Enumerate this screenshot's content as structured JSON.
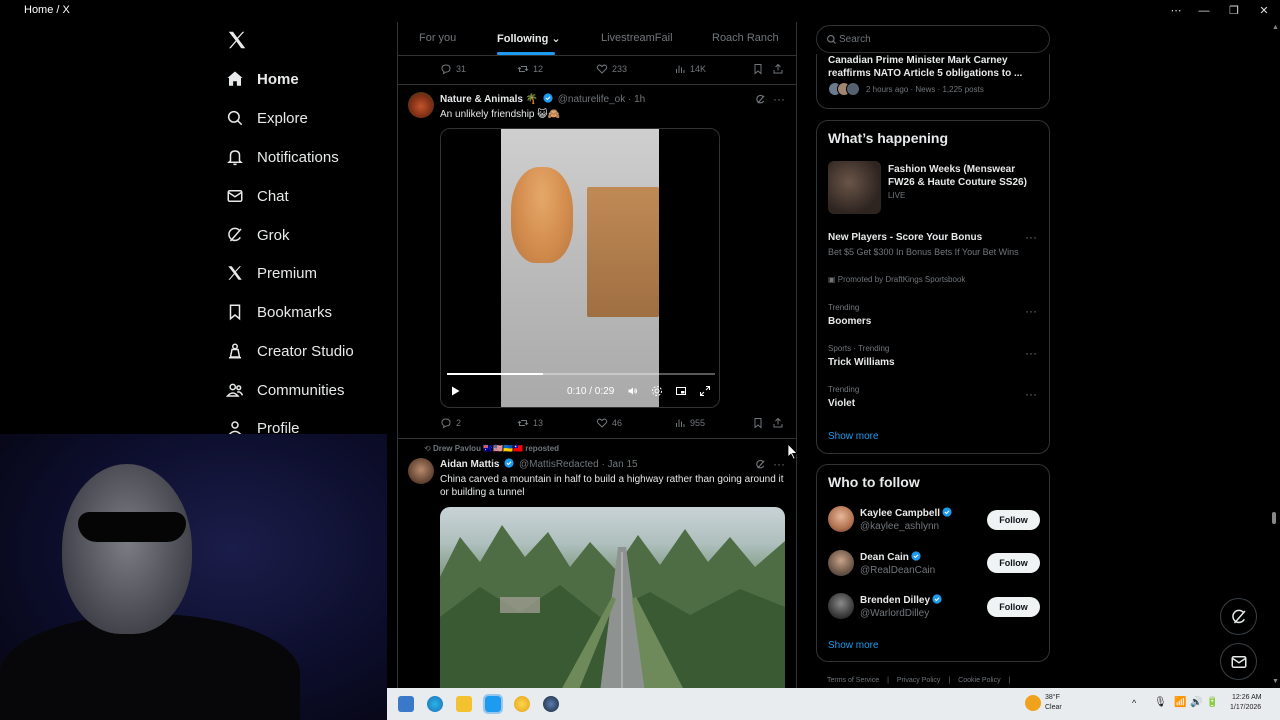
{
  "window": {
    "title": "Home / X"
  },
  "nav": {
    "items": [
      {
        "label": "Home",
        "icon": "home-icon"
      },
      {
        "label": "Explore",
        "icon": "search-icon"
      },
      {
        "label": "Notifications",
        "icon": "bell-icon"
      },
      {
        "label": "Chat",
        "icon": "mail-icon"
      },
      {
        "label": "Grok",
        "icon": "grok-icon"
      },
      {
        "label": "Premium",
        "icon": "x-icon"
      },
      {
        "label": "Bookmarks",
        "icon": "bookmark-icon"
      },
      {
        "label": "Creator Studio",
        "icon": "creator-icon"
      },
      {
        "label": "Communities",
        "icon": "people-icon"
      },
      {
        "label": "Profile",
        "icon": "person-icon"
      }
    ]
  },
  "tabs": [
    {
      "label": "For you"
    },
    {
      "label": "Following"
    },
    {
      "label": "LivestreamFail"
    },
    {
      "label": "Roach Ranch"
    }
  ],
  "feed": {
    "prev_stats": {
      "replies": "31",
      "reposts": "12",
      "likes": "233",
      "views": "14K"
    },
    "post1": {
      "name": "Nature & Animals 🌴",
      "handle": "@naturelife_ok",
      "time": "· 1h",
      "text": "An unlikely friendship 😺🙈",
      "video_time": "0:10 / 0:29",
      "progress": 0.36,
      "stats": {
        "replies": "2",
        "reposts": "13",
        "likes": "46",
        "views": "955"
      }
    },
    "post2": {
      "repost_by": "Drew Pavlou 🇦🇺🇺🇸🇺🇦🇹🇼 reposted",
      "name": "Aidan Mattis",
      "handle": "@MattisRedacted",
      "time": "· Jan 15",
      "text": "China carved a mountain in half to build a highway rather than going around it or building a tunnel"
    }
  },
  "search": {
    "placeholder": "Search"
  },
  "news": {
    "title": "Canadian Prime Minister Mark Carney reaffirms NATO Article 5 obligations to ...",
    "meta": "2 hours ago · News · 1,225 posts"
  },
  "happening": {
    "title": "What’s happening",
    "event": {
      "title": "Fashion Weeks (Menswear FW26 & Haute Couture SS26)",
      "status": "LIVE"
    },
    "promo": {
      "title": "New Players - Score Your Bonus",
      "desc": "Bet $5 Get $300 In Bonus Bets If Your Bet Wins",
      "by": "Promoted by DraftKings Sportsbook"
    },
    "trends": [
      {
        "context": "Trending",
        "name": "Boomers"
      },
      {
        "context": "Sports · Trending",
        "name": "Trick Williams"
      },
      {
        "context": "Trending",
        "name": "Violet"
      }
    ],
    "show_more": "Show more"
  },
  "who_to_follow": {
    "title": "Who to follow",
    "users": [
      {
        "name": "Kaylee Campbell",
        "handle": "@kaylee_ashlynn",
        "button": "Follow"
      },
      {
        "name": "Dean Cain",
        "handle": "@RealDeanCain",
        "button": "Follow"
      },
      {
        "name": "Brenden Dilley",
        "handle": "@WarlordDilley",
        "button": "Follow"
      }
    ],
    "show_more": "Show more"
  },
  "footer": {
    "links": [
      "Terms of Service",
      "|",
      "Privacy Policy",
      "|",
      "Cookie Policy",
      "|"
    ]
  },
  "taskbar": {
    "temp": "38°F",
    "weather": "Clear",
    "time": "12:26 AM",
    "date": "1/17/2026"
  },
  "colors": {
    "accent": "#1d9bf0",
    "verified": "#1d9bf0",
    "border": "#2f3336",
    "muted": "#71767b"
  }
}
